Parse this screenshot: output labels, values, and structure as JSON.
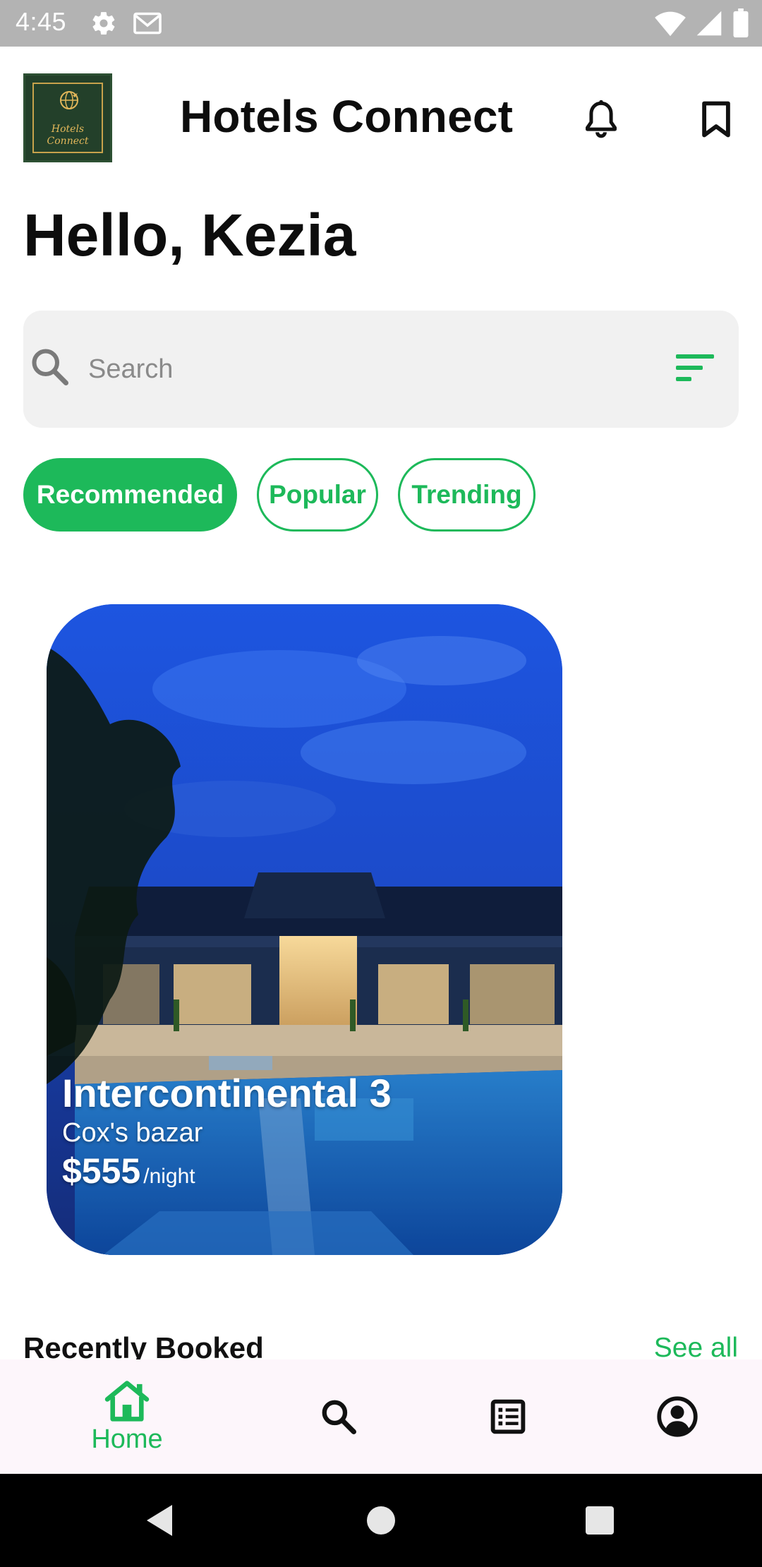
{
  "status_bar": {
    "time": "4:45",
    "icons": [
      "settings-gear-icon",
      "gmail-icon",
      "wifi-icon",
      "cell-signal-icon",
      "battery-icon"
    ]
  },
  "header": {
    "logo_lines": [
      "Hotels",
      "Connect"
    ],
    "title": "Hotels Connect",
    "icons": [
      "bell-icon",
      "bookmark-icon"
    ]
  },
  "greeting": "Hello, Kezia",
  "search": {
    "placeholder": "Search",
    "value": ""
  },
  "chips": [
    {
      "label": "Recommended",
      "active": true
    },
    {
      "label": "Popular",
      "active": false
    },
    {
      "label": "Trending",
      "active": false
    }
  ],
  "hotel_card": {
    "name": "Intercontinental 3",
    "location": "Cox's bazar",
    "price": "$555",
    "price_unit": "/night"
  },
  "recently_booked": {
    "title": "Recently Booked",
    "see_all": "See all"
  },
  "bottom_nav": {
    "home_label": "Home",
    "items": [
      "home-icon",
      "search-icon",
      "bookings-list-icon",
      "profile-icon"
    ]
  },
  "colors": {
    "accent": "#1db95a",
    "status_bar": "#b3b3b3",
    "nav_background": "#fdf6fb",
    "logo_background": "#23402a"
  }
}
